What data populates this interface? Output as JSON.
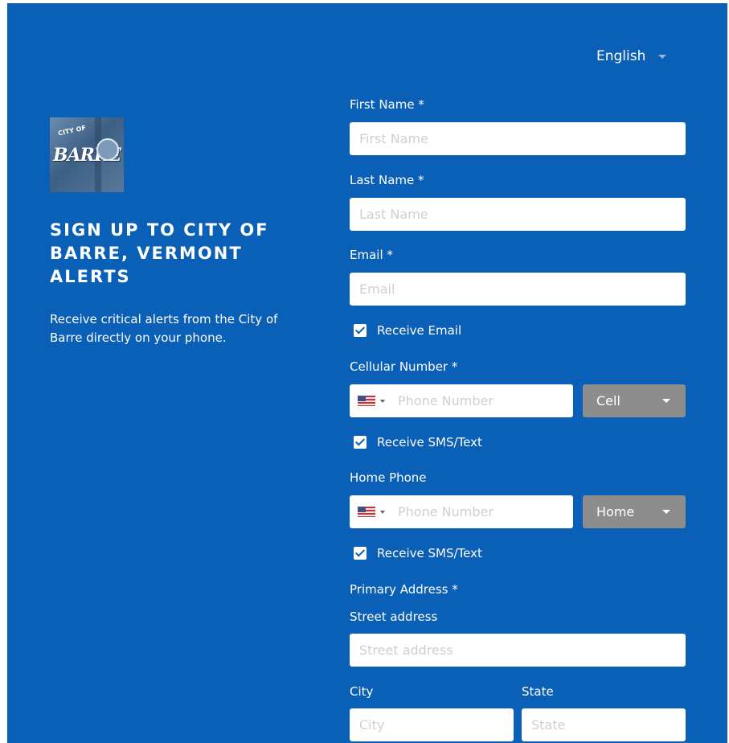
{
  "language": {
    "selected": "English"
  },
  "hero": {
    "title": "SIGN UP TO CITY OF BARRE, VERMONT ALERTS",
    "description": "Receive critical alerts from the City of Barre directly on your phone."
  },
  "logo": {
    "text": "BARRE",
    "small_text": "CITY OF"
  },
  "form": {
    "first_name": {
      "label": "First Name *",
      "placeholder": "First Name"
    },
    "last_name": {
      "label": "Last Name *",
      "placeholder": "Last Name"
    },
    "email": {
      "label": "Email *",
      "placeholder": "Email"
    },
    "receive_email": {
      "label": "Receive Email",
      "checked": true
    },
    "cellular": {
      "label": "Cellular Number *",
      "placeholder": "Phone Number",
      "type": "Cell",
      "country": "us-flag"
    },
    "cell_sms": {
      "label": "Receive SMS/Text",
      "checked": true
    },
    "home_phone": {
      "label": "Home Phone",
      "placeholder": "Phone Number",
      "type": "Home",
      "country": "us-flag"
    },
    "home_sms": {
      "label": "Receive SMS/Text",
      "checked": true
    },
    "primary_address": {
      "label": "Primary Address *"
    },
    "street": {
      "label": "Street address",
      "placeholder": "Street address"
    },
    "city": {
      "label": "City",
      "placeholder": "City"
    },
    "state": {
      "label": "State",
      "placeholder": "State"
    }
  },
  "colors": {
    "background": "#0a5fb6",
    "select": "#8d8d8d",
    "input": "#ffffff"
  }
}
